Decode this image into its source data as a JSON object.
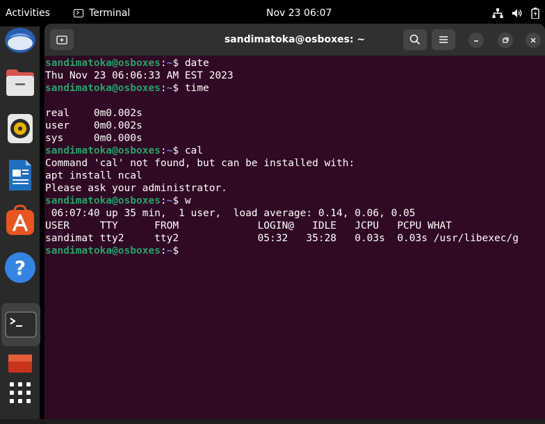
{
  "topbar": {
    "activities": "Activities",
    "app_name": "Terminal",
    "clock": "Nov 23  06:07",
    "tray_icons": [
      "network-icon",
      "volume-icon",
      "battery-icon"
    ]
  },
  "dock": {
    "items": [
      "thunderbird-icon",
      "files-icon",
      "rhythmbox-icon",
      "writer-icon",
      "app-center-icon",
      "help-icon",
      "terminal-icon",
      "screenshot-icon",
      "show-apps-icon"
    ]
  },
  "window": {
    "title": "sandimatoka@osboxes: ~"
  },
  "terminal": {
    "prompt_user": "sandimatoka@osboxes",
    "prompt_path": "~",
    "lines": [
      {
        "type": "prompt",
        "cmd": "date"
      },
      {
        "type": "out",
        "text": "Thu Nov 23 06:06:33 AM EST 2023"
      },
      {
        "type": "prompt",
        "cmd": "time"
      },
      {
        "type": "out",
        "text": ""
      },
      {
        "type": "out",
        "text": "real    0m0.002s"
      },
      {
        "type": "out",
        "text": "user    0m0.002s"
      },
      {
        "type": "out",
        "text": "sys     0m0.000s"
      },
      {
        "type": "prompt",
        "cmd": "cal"
      },
      {
        "type": "out",
        "text": "Command 'cal' not found, but can be installed with:"
      },
      {
        "type": "out",
        "text": "apt install ncal"
      },
      {
        "type": "out",
        "text": "Please ask your administrator."
      },
      {
        "type": "prompt",
        "cmd": "w"
      },
      {
        "type": "out",
        "text": " 06:07:40 up 35 min,  1 user,  load average: 0.14, 0.06, 0.05"
      },
      {
        "type": "out",
        "text": "USER     TTY      FROM             LOGIN@   IDLE   JCPU   PCPU WHAT"
      },
      {
        "type": "out",
        "text": "sandimat tty2     tty2             05:32   35:28   0.03s  0.03s /usr/libexec/g"
      },
      {
        "type": "prompt",
        "cmd": ""
      }
    ]
  },
  "colors": {
    "terminal_bg": "#300a24",
    "prompt_user": "#26a269",
    "prompt_path": "#5c88d6",
    "headerbar": "#303030",
    "dock": "#2a2a2a"
  }
}
